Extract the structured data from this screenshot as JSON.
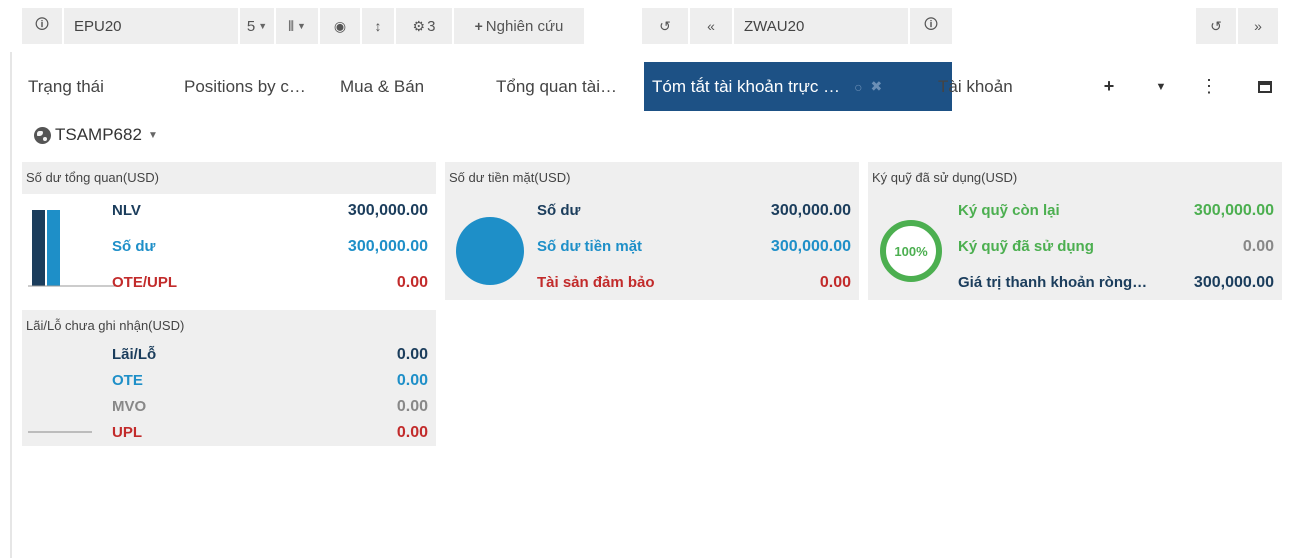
{
  "toolbar": {
    "left_symbol": "EPU20",
    "layout_count": "5",
    "settings_count": "3",
    "research_label": "Nghiên cứu",
    "right_symbol": "ZWAU20"
  },
  "tabs": {
    "items": [
      {
        "label": "Trạng thái"
      },
      {
        "label": "Positions by c…"
      },
      {
        "label": "Mua & Bán"
      },
      {
        "label": "Tổng quan tài…"
      },
      {
        "label": "Tóm tắt tài khoản trực …"
      },
      {
        "label": "Tài khoản"
      }
    ]
  },
  "account": {
    "name": "TSAMP682"
  },
  "panels": {
    "balance_overview": {
      "title": "Số dư tổng quan(USD)",
      "rows": [
        {
          "label": "NLV",
          "value": "300,000.00"
        },
        {
          "label": "Số dư",
          "value": "300,000.00"
        },
        {
          "label": "OTE/UPL",
          "value": "0.00"
        }
      ]
    },
    "cash_balance": {
      "title": "Số dư tiền mặt(USD)",
      "rows": [
        {
          "label": "Số dư",
          "value": "300,000.00"
        },
        {
          "label": "Số dư tiền mặt",
          "value": "300,000.00"
        },
        {
          "label": "Tài sản đảm bảo",
          "value": "0.00"
        }
      ]
    },
    "margin_used": {
      "title": "Ký quỹ đã sử dụng(USD)",
      "ring_label": "100%",
      "ring_fraction": 1.0,
      "rows": [
        {
          "label": "Ký quỹ còn lại",
          "value": "300,000.00"
        },
        {
          "label": "Ký quỹ đã sử dụng",
          "value": "0.00"
        },
        {
          "label": "Giá trị thanh khoản ròng…",
          "value": "300,000.00"
        }
      ]
    },
    "unrealized_pl": {
      "title": "Lãi/Lỗ chưa ghi nhận(USD)",
      "rows": [
        {
          "label": "Lãi/Lỗ",
          "value": "0.00"
        },
        {
          "label": "OTE",
          "value": "0.00"
        },
        {
          "label": "MVO",
          "value": "0.00"
        },
        {
          "label": "UPL",
          "value": "0.00"
        }
      ]
    }
  },
  "colors": {
    "active_tab": "#1d5185",
    "navy": "#1b3d5c",
    "blue": "#1e8fc8",
    "red": "#c22b2b",
    "green": "#4caf50",
    "gray": "#888888"
  }
}
